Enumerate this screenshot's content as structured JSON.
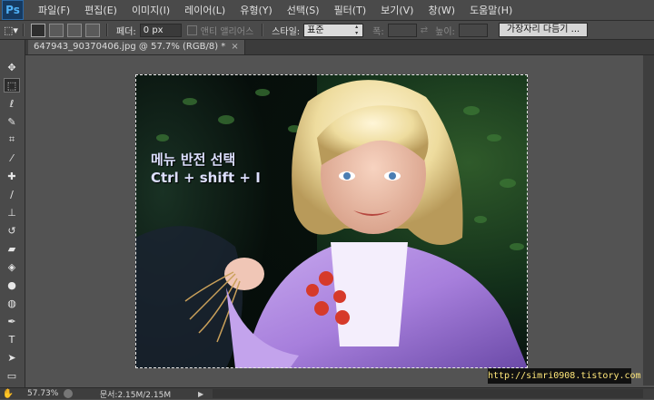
{
  "app": {
    "logo": "Ps"
  },
  "menu": [
    "파일(F)",
    "편집(E)",
    "이미지(I)",
    "레이어(L)",
    "유형(Y)",
    "선택(S)",
    "필터(T)",
    "보기(V)",
    "창(W)",
    "도움말(H)"
  ],
  "options": {
    "feather_label": "페더:",
    "feather_value": "0 px",
    "antialias_label": "앤티 앨리어스",
    "style_label": "스타일:",
    "style_value": "표준",
    "width_label": "폭:",
    "height_label": "높이:",
    "refine_button": "가장자리 다듬기 ..."
  },
  "document": {
    "tab_title": "647943_90370406.jpg @ 57.7% (RGB/8) *",
    "tab_close": "×"
  },
  "overlay": {
    "line1": "메뉴 반전 선택",
    "line2": "Ctrl + shift + I"
  },
  "watermark": "http://simri0908.tistory.com",
  "status": {
    "zoom": "57.73%",
    "doc_size": "문서:2.15M/2.15M",
    "menu_arrow": "▶"
  },
  "tools": [
    "move-tool",
    "rectangular-marquee-tool",
    "lasso-tool",
    "quick-selection-tool",
    "crop-tool",
    "eyedropper-tool",
    "spot-healing-tool",
    "brush-tool",
    "clone-stamp-tool",
    "history-brush-tool",
    "eraser-tool",
    "paint-bucket-tool",
    "blur-tool",
    "dodge-tool",
    "pen-tool",
    "type-tool",
    "path-selection-tool",
    "rectangle-tool",
    "hand-tool"
  ],
  "colors": {
    "ui_dark": "#4a4a4a",
    "canvas_bg": "#535353",
    "ps_blue": "#4fb0f5",
    "watermark_text": "#ffe77a"
  }
}
